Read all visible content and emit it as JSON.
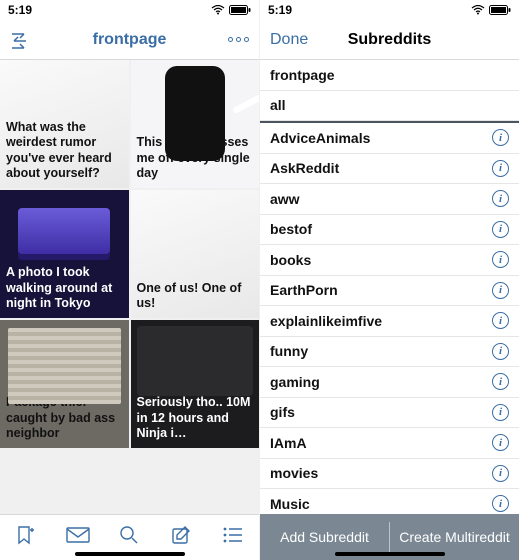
{
  "colors": {
    "accent": "#3a6ea5",
    "bottomBar": "#7b8894"
  },
  "status": {
    "time": "5:19"
  },
  "left": {
    "title": "frontpage",
    "cards": [
      {
        "title": "What was the weirdest rumor you've ever heard about yourself?",
        "variant": ""
      },
      {
        "title": "This design pisses me off every single day",
        "variant": "phone"
      },
      {
        "title": "A photo I took walking around at night in Tokyo",
        "variant": "tokyo dark"
      },
      {
        "title": "One of us! One of us!",
        "variant": ""
      },
      {
        "title": "Package thief caught by bad ass neighbor",
        "variant": "garage"
      },
      {
        "title": "Seriously tho.. 10M in 12 hours and Ninja i…",
        "variant": "tweet"
      }
    ],
    "tabs": [
      {
        "name": "bookmark-icon"
      },
      {
        "name": "mail-icon"
      },
      {
        "name": "search-icon"
      },
      {
        "name": "compose-icon"
      },
      {
        "name": "list-icon"
      }
    ]
  },
  "right": {
    "done": "Done",
    "title": "Subreddits",
    "top": [
      {
        "label": "frontpage"
      },
      {
        "label": "all"
      }
    ],
    "subs": [
      {
        "label": "AdviceAnimals"
      },
      {
        "label": "AskReddit"
      },
      {
        "label": "aww"
      },
      {
        "label": "bestof"
      },
      {
        "label": "books"
      },
      {
        "label": "EarthPorn"
      },
      {
        "label": "explainlikeimfive"
      },
      {
        "label": "funny"
      },
      {
        "label": "gaming"
      },
      {
        "label": "gifs"
      },
      {
        "label": "IAmA"
      },
      {
        "label": "movies"
      },
      {
        "label": "Music"
      }
    ],
    "bottom": {
      "add": "Add Subreddit",
      "create": "Create Multireddit"
    }
  }
}
